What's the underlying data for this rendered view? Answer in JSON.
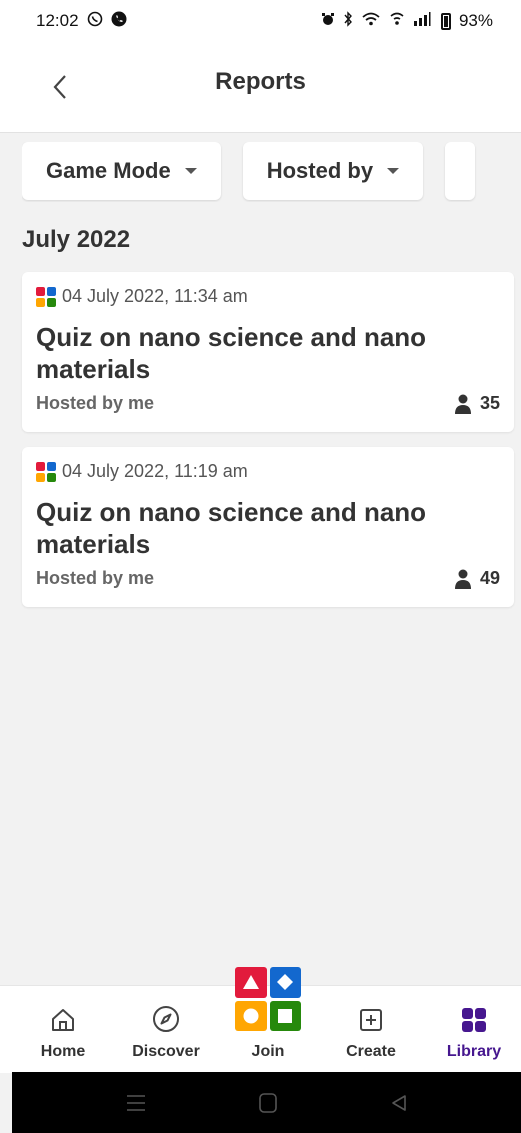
{
  "status_bar": {
    "time": "12:02",
    "battery": "93%",
    "left_icons": [
      "whatsapp-icon",
      "phone-icon"
    ],
    "right_icons": [
      "alarm-icon",
      "bluetooth-icon",
      "wifi-icon",
      "wifi-calling-icon",
      "signal-icon",
      "battery-icon"
    ]
  },
  "header": {
    "title": "Reports",
    "back_icon": "chevron-left-icon"
  },
  "filters": {
    "items": [
      {
        "label": "Game Mode"
      },
      {
        "label": "Hosted by"
      }
    ]
  },
  "section": {
    "month": "July 2022"
  },
  "reports": [
    {
      "date": "04 July 2022, 11:34 am",
      "title": "Quiz on nano science and nano materials",
      "hosted": "Hosted by me",
      "players": "35"
    },
    {
      "date": "04 July 2022, 11:19 am",
      "title": "Quiz on nano science and nano materials",
      "hosted": "Hosted by me",
      "players": "49"
    }
  ],
  "bottom_nav": {
    "items": [
      {
        "label": "Home",
        "icon": "home-icon"
      },
      {
        "label": "Discover",
        "icon": "compass-icon"
      },
      {
        "label": "Join",
        "icon": "kahoot-shapes-icon"
      },
      {
        "label": "Create",
        "icon": "plus-square-icon"
      },
      {
        "label": "Library",
        "icon": "grid-icon",
        "active": true
      }
    ]
  },
  "colors": {
    "accent": "#46178f",
    "red": "#e21b3c",
    "blue": "#1368ce",
    "yellow": "#ffa602",
    "green": "#26890c"
  }
}
